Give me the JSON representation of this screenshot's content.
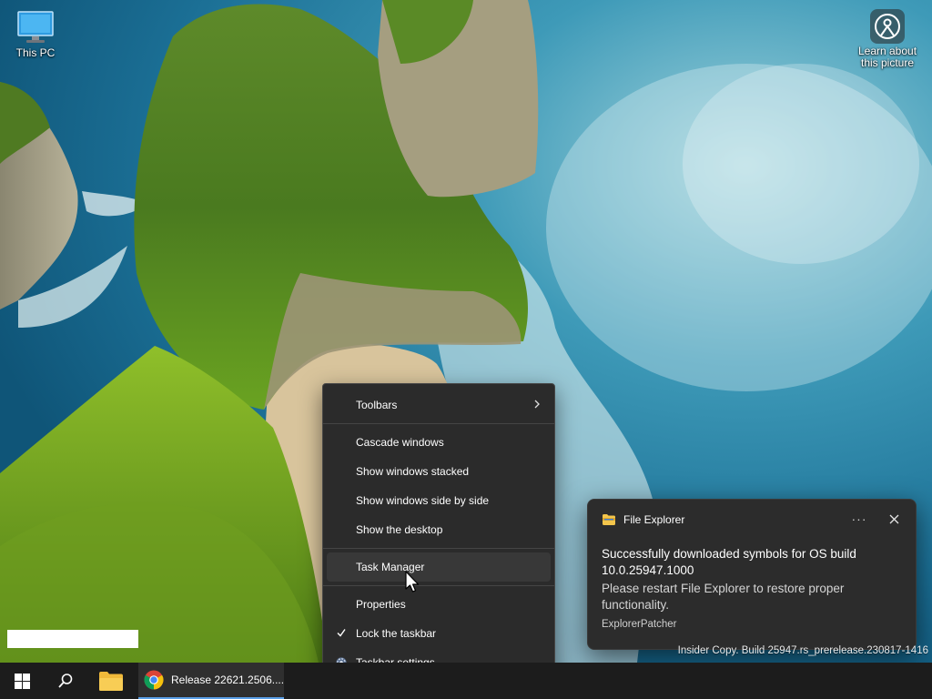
{
  "desktop": {
    "icons": [
      {
        "label": "This PC",
        "icon": "monitor-icon"
      },
      {
        "label": "Learn about this picture",
        "icon": "camera-location-icon"
      }
    ],
    "watermark": "Insider Copy. Build 25947.rs_prerelease.230817-1416"
  },
  "context_menu": {
    "items": [
      {
        "label": "Toolbars",
        "has_submenu": true
      },
      {
        "label": "Cascade windows"
      },
      {
        "label": "Show windows stacked"
      },
      {
        "label": "Show windows side by side"
      },
      {
        "label": "Show the desktop"
      },
      {
        "label": "Task Manager",
        "hovered": true
      },
      {
        "label": "Properties"
      },
      {
        "label": "Lock the taskbar",
        "checked": true
      },
      {
        "label": "Taskbar settings",
        "icon": "gear-icon"
      }
    ]
  },
  "notification": {
    "app_name": "File Explorer",
    "more_label": "···",
    "title": "Successfully downloaded symbols for OS build 10.0.25947.1000",
    "body": "Please restart File Explorer to restore proper functionality.",
    "attribution": "ExplorerPatcher"
  },
  "taskbar": {
    "start_icon": "windows-logo-icon",
    "search_icon": "search-icon",
    "explorer_icon": "folder-icon",
    "chrome_window_title": "Release 22621.2506....",
    "active_indicator_color": "#5aa0e8"
  },
  "colors": {
    "menu_bg": "#2b2b2b",
    "toast_bg": "#2c2c2c",
    "taskbar_bg": "#1c1c1c",
    "accent": "#5aa0e8"
  }
}
